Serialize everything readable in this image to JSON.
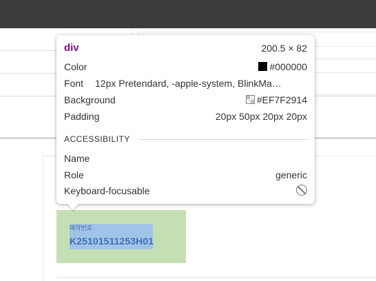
{
  "tooltip": {
    "tag": "div",
    "dimensions": "200.5 × 82",
    "rows": {
      "color": {
        "label": "Color",
        "value": "#000000",
        "swatch": "#000000"
      },
      "font": {
        "label": "Font",
        "value": "12px Pretendard, -apple-system, BlinkMa…"
      },
      "background": {
        "label": "Background",
        "value": "#EF7F2914"
      },
      "padding": {
        "label": "Padding",
        "value": "20px 50px 20px 20px"
      }
    },
    "accessibility": {
      "section_title": "ACCESSIBILITY",
      "name_label": "Name",
      "role_label": "Role",
      "role_value": "generic",
      "focusable_label": "Keyboard-focusable",
      "focusable_icon": "blocked-icon"
    }
  },
  "inspected": {
    "label": "예약번호",
    "value": "K25101511253H01"
  },
  "colors": {
    "topbar": "#3c3c3c",
    "padding_overlay": "#c5dfb4",
    "content_overlay": "#a0c4e8",
    "tag_color": "#881280"
  }
}
